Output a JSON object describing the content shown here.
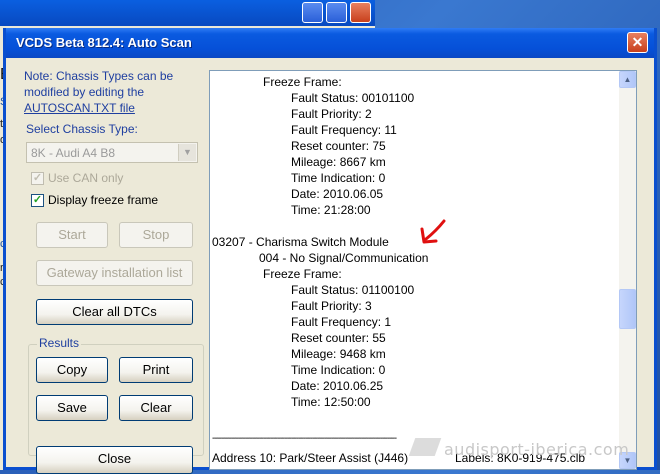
{
  "background_window": {
    "fragments": [
      "E",
      "Sc",
      "to",
      "or",
      "ca",
      "re",
      "co"
    ]
  },
  "dialog": {
    "title": "VCDS Beta 812.4:  Auto Scan",
    "close_glyph": "✕",
    "note_prefix": "Note:  Chassis Types can be modified by editing the",
    "note_link": "AUTOSCAN.TXT file",
    "chassis_label": "Select Chassis Type:",
    "chassis_value": "8K - Audi A4 B8",
    "use_can_label": "Use CAN only",
    "use_can_checked": true,
    "freeze_label": "Display freeze frame",
    "freeze_checked": true,
    "start_label": "Start",
    "stop_label": "Stop",
    "gateway_label": "Gateway installation list",
    "clear_dtcs_label": "Clear all DTCs",
    "results_label": "Results",
    "copy_label": "Copy",
    "print_label": "Print",
    "save_label": "Save",
    "clear_label": "Clear",
    "close_label": "Close"
  },
  "report": {
    "lines": [
      "Freeze Frame:",
      "Fault Status: 00101100",
      "Fault Priority: 2",
      "Fault Frequency: 11",
      "Reset counter: 75",
      "Mileage: 8667 km",
      "Time Indication: 0",
      "Date: 2010.06.05",
      "Time: 21:28:00",
      "03207 - Charisma Switch Module",
      "004 - No Signal/Communication",
      "Freeze Frame:",
      "Fault Status: 01100100",
      "Fault Priority: 3",
      "Fault Frequency: 1",
      "Reset counter: 55",
      "Mileage: 9468 km",
      "Time Indication: 0",
      "Date: 2010.06.25",
      "Time: 12:50:00",
      "-------------------------------------------------------------------------------",
      "Address 10: Park/Steer Assist (J446)",
      "Labels: 8K0-919-475.clb"
    ]
  },
  "scroll": {
    "up": "▲",
    "down": "▼"
  },
  "watermark": "audisport-iberica.com",
  "colors": {
    "title_bar": "#0650d8",
    "label_blue": "#1f3fa0",
    "annotation_arrow": "#e01010"
  }
}
